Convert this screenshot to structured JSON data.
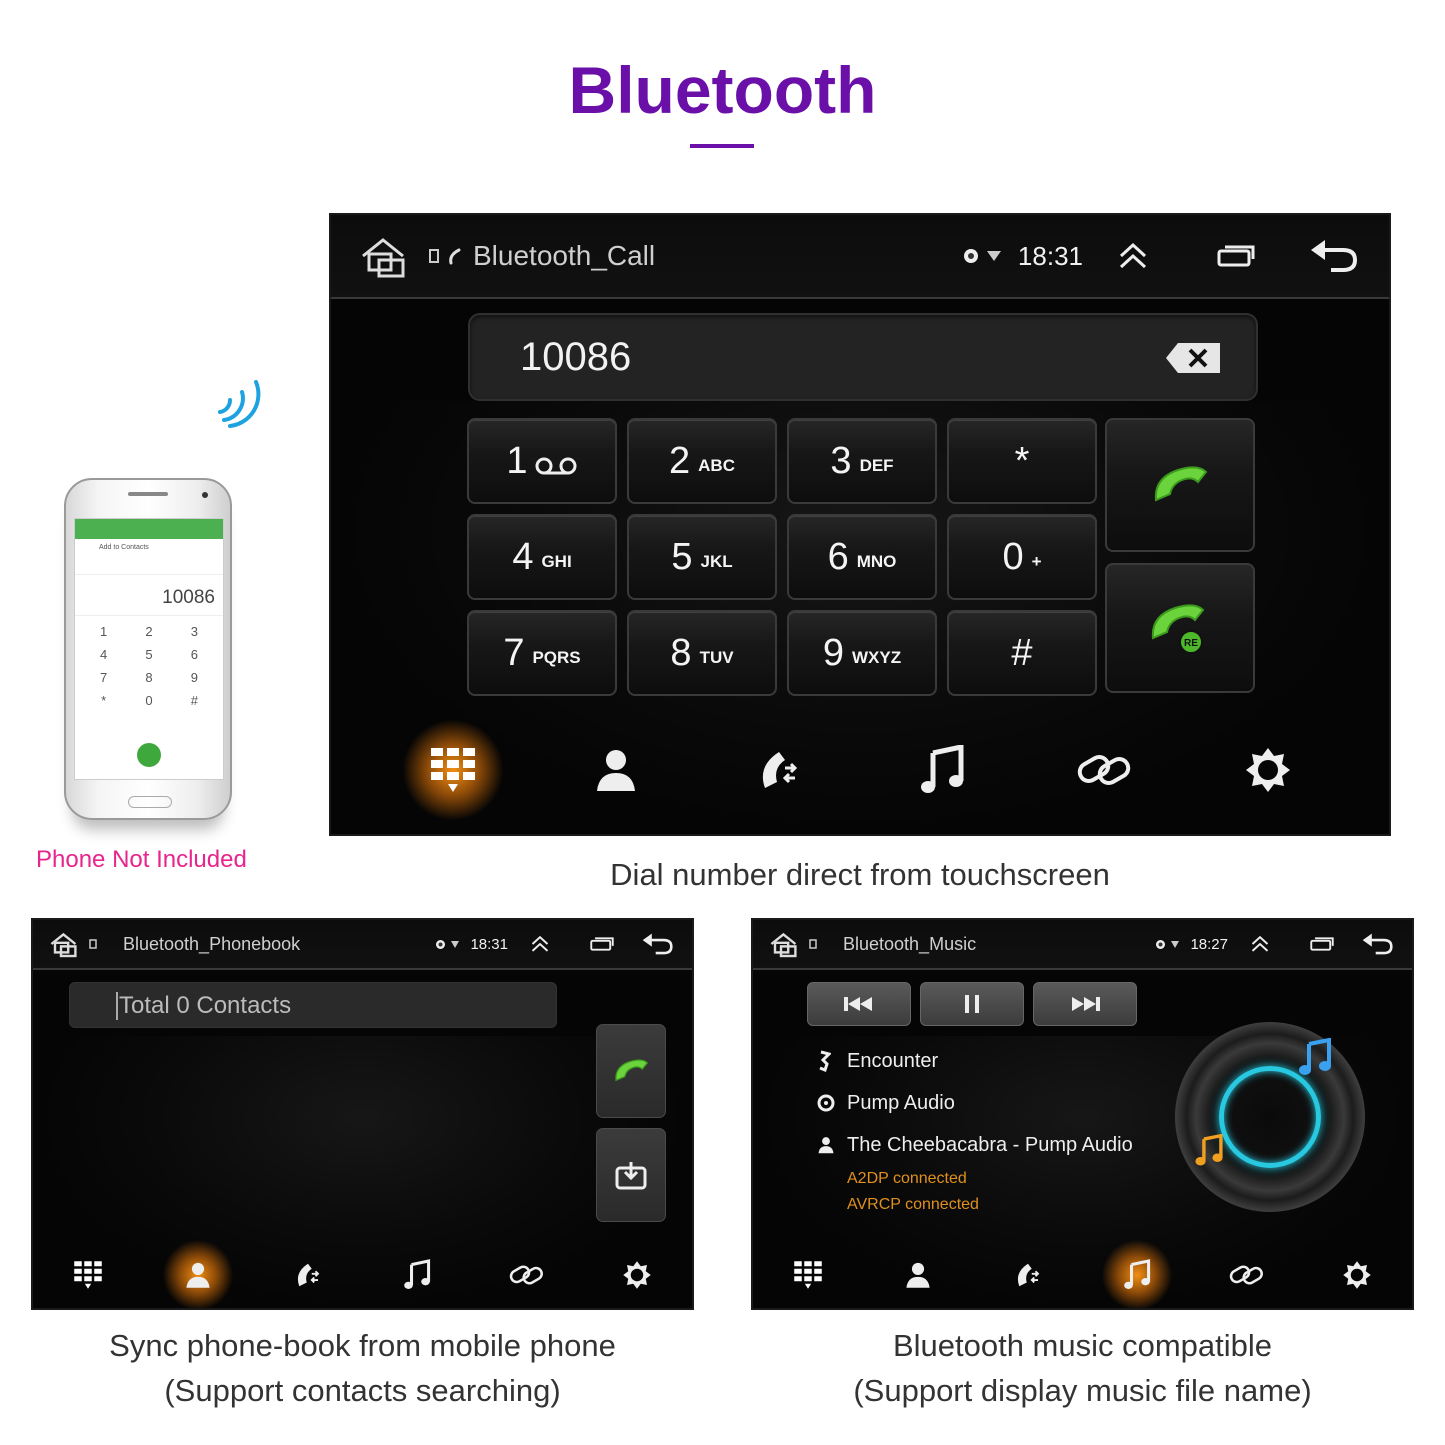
{
  "header": {
    "title": "Bluetooth"
  },
  "phone_illustration": {
    "app_bar_action": "Add to Contacts",
    "number": "10086",
    "keys": [
      "1",
      "2",
      "3",
      "4",
      "5",
      "6",
      "7",
      "8",
      "9",
      "*",
      "0",
      "#"
    ],
    "note": "Phone Not Included",
    "accent_color": "#4caf50"
  },
  "main_screen": {
    "status": {
      "title": "Bluetooth_Call",
      "time": "18:31"
    },
    "dial_value": "10086",
    "keys": [
      {
        "digit": "1",
        "letters": "voicemail-icon"
      },
      {
        "digit": "2",
        "letters": "ABC"
      },
      {
        "digit": "3",
        "letters": "DEF"
      },
      {
        "digit": "*",
        "letters": ""
      },
      {
        "digit": "4",
        "letters": "GHI"
      },
      {
        "digit": "5",
        "letters": "JKL"
      },
      {
        "digit": "6",
        "letters": "MNO"
      },
      {
        "digit": "0",
        "letters": "+"
      },
      {
        "digit": "7",
        "letters": "PQRS"
      },
      {
        "digit": "8",
        "letters": "TUV"
      },
      {
        "digit": "9",
        "letters": "WXYZ"
      },
      {
        "digit": "#",
        "letters": ""
      }
    ],
    "call_buttons": [
      "call-icon",
      "redial-icon"
    ],
    "redial_badge": "RE",
    "nav": [
      "dialpad-icon",
      "contacts-icon",
      "call-log-icon",
      "music-icon",
      "link-icon",
      "settings-icon"
    ],
    "active_nav": 0,
    "caption": "Dial number direct from touchscreen"
  },
  "phonebook_screen": {
    "status": {
      "title": "Bluetooth_Phonebook",
      "time": "18:31"
    },
    "search_text": "Total 0 Contacts",
    "side_buttons": [
      "call-icon",
      "download-icon"
    ],
    "active_nav": 1,
    "caption_line1": "Sync phone-book from mobile phone",
    "caption_line2": "(Support contacts searching)"
  },
  "music_screen": {
    "status": {
      "title": "Bluetooth_Music",
      "time": "18:27"
    },
    "controls": [
      "previous-icon",
      "pause-icon",
      "next-icon"
    ],
    "track": {
      "title": "Encounter",
      "album": "Pump Audio",
      "artist": "The Cheebacabra - Pump Audio"
    },
    "connection_status": [
      "A2DP connected",
      "AVRCP connected"
    ],
    "active_nav": 3,
    "caption_line1": "Bluetooth music compatible",
    "caption_line2": "(Support display music file name)"
  },
  "colors": {
    "title": "#6a0fa8",
    "note": "#e8258c",
    "glow": "#ff9614",
    "call_green": "#6bd43c",
    "ring": "#27c8e0",
    "status_text": "#e0901e"
  }
}
